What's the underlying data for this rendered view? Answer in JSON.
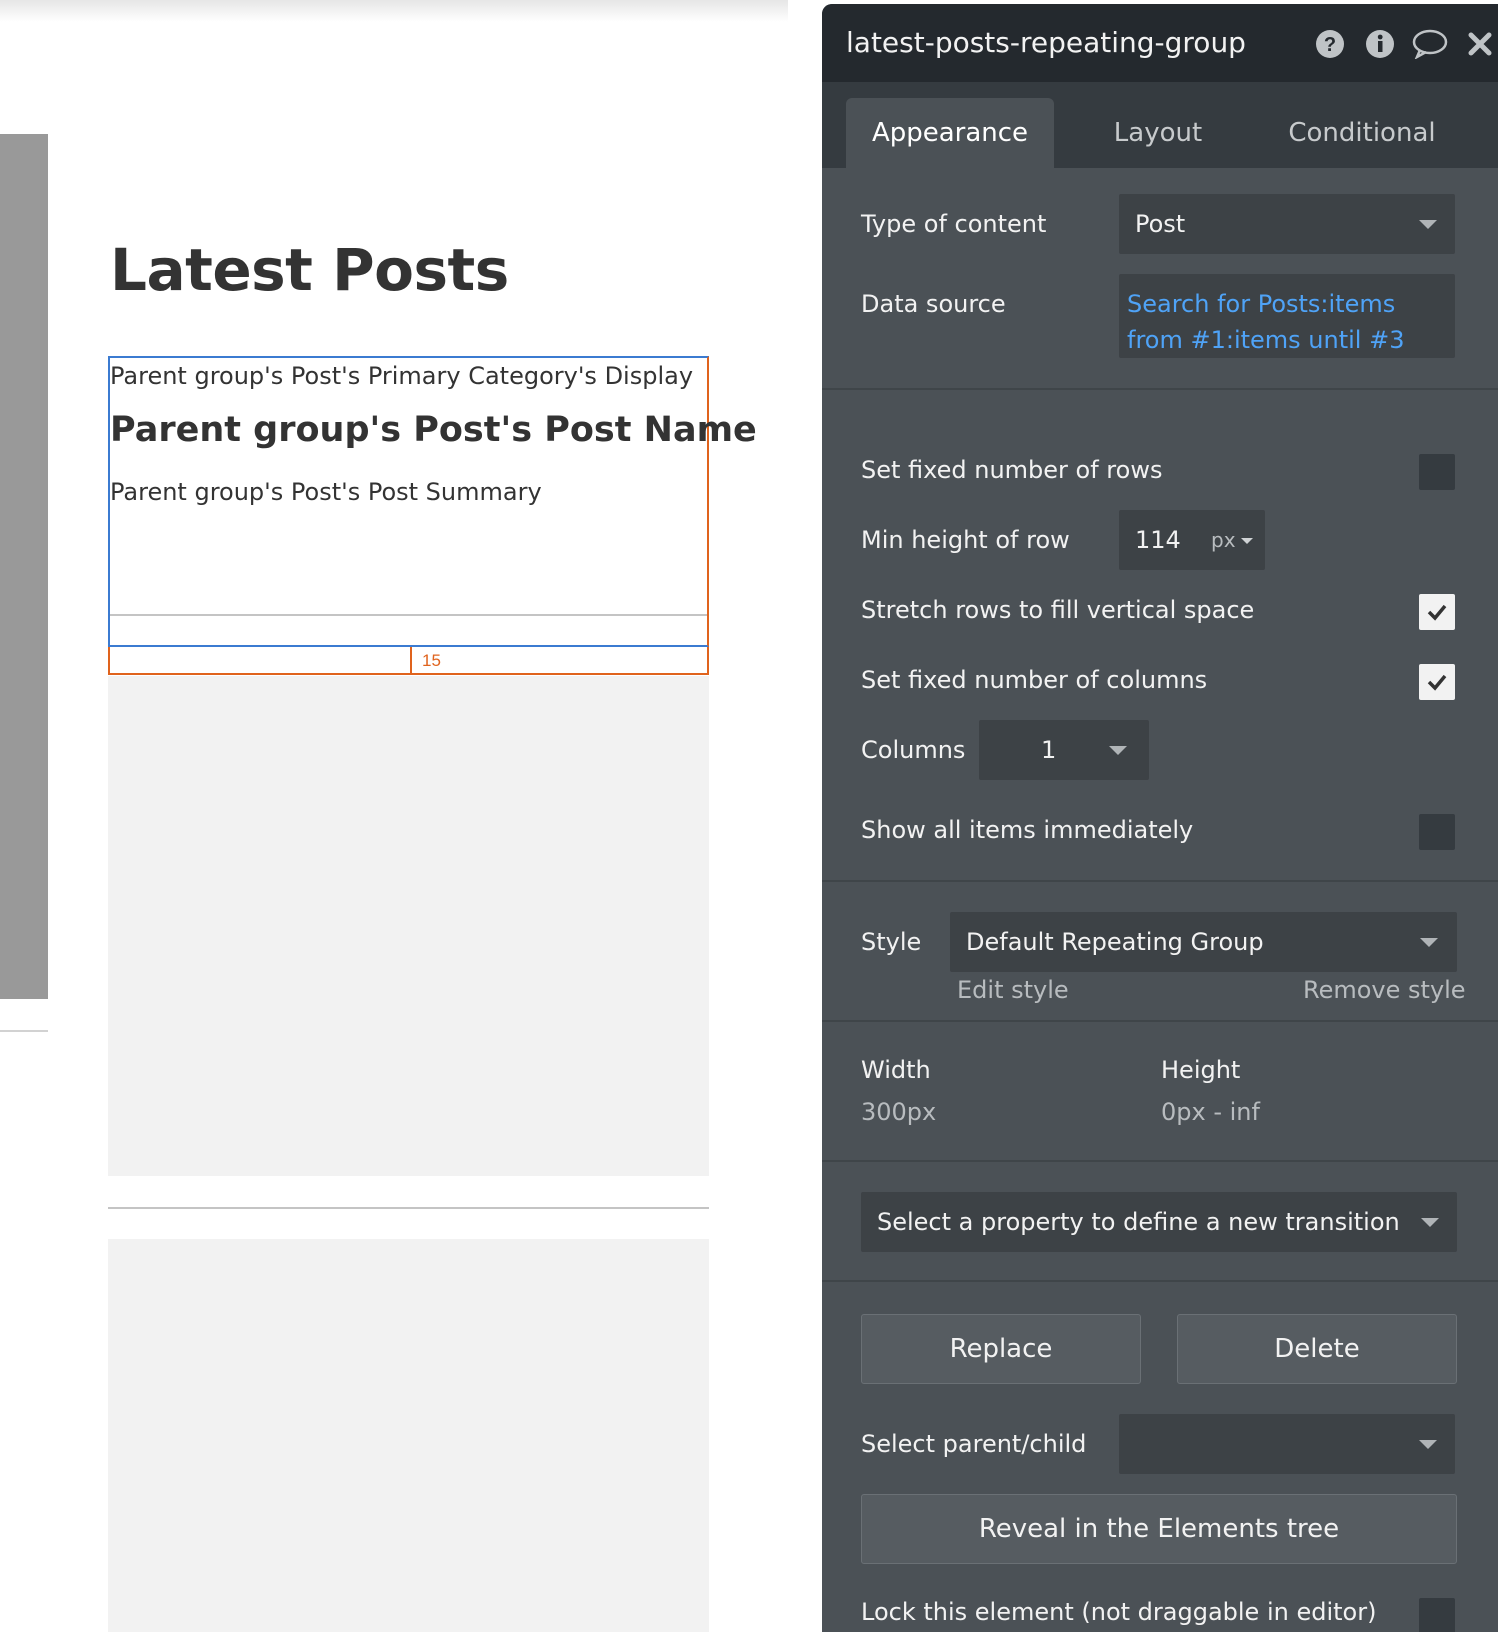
{
  "canvas": {
    "page_title": "Latest Posts",
    "cell": {
      "category_text": "Parent group's Post's Primary Category's Display",
      "name_text": "Parent group's Post's Post Name",
      "summary_text": "Parent group's Post's Post Summary"
    },
    "spacing_label": "15"
  },
  "panel": {
    "title": "latest-posts-repeating-group",
    "icons": [
      "question-icon",
      "info-icon",
      "comment-icon",
      "close-icon"
    ],
    "tabs": [
      "Appearance",
      "Layout",
      "Conditional"
    ],
    "active_tab": "Appearance",
    "type_of_content": {
      "label": "Type of content",
      "value": "Post"
    },
    "data_source": {
      "label": "Data source",
      "value": "Search for Posts:items from #1:items until #3"
    },
    "fixed_rows": {
      "label": "Set fixed number of rows",
      "checked": false
    },
    "min_height": {
      "label": "Min height of row",
      "value": "114",
      "unit": "px"
    },
    "stretch_rows": {
      "label": "Stretch rows to fill vertical space",
      "checked": true
    },
    "fixed_columns": {
      "label": "Set fixed number of columns",
      "checked": true
    },
    "columns": {
      "label": "Columns",
      "value": "1"
    },
    "show_all": {
      "label": "Show all items immediately",
      "checked": false
    },
    "style": {
      "label": "Style",
      "value": "Default Repeating Group",
      "edit_label": "Edit style",
      "remove_label": "Remove style"
    },
    "size": {
      "width_label": "Width",
      "width_value": "300px",
      "height_label": "Height",
      "height_value": "0px - inf"
    },
    "transition_placeholder": "Select a property to define a new transition",
    "replace_label": "Replace",
    "delete_label": "Delete",
    "parent_child_label": "Select parent/child",
    "reveal_label": "Reveal in the Elements tree",
    "lock_label": "Lock this element (not draggable in editor)"
  },
  "colors": {
    "panel_bg": "#4b5156",
    "header_bg": "#24292e",
    "link_blue": "#4fa3f7",
    "selection_blue": "#3b7bd1",
    "spacing_orange": "#e0631d"
  }
}
